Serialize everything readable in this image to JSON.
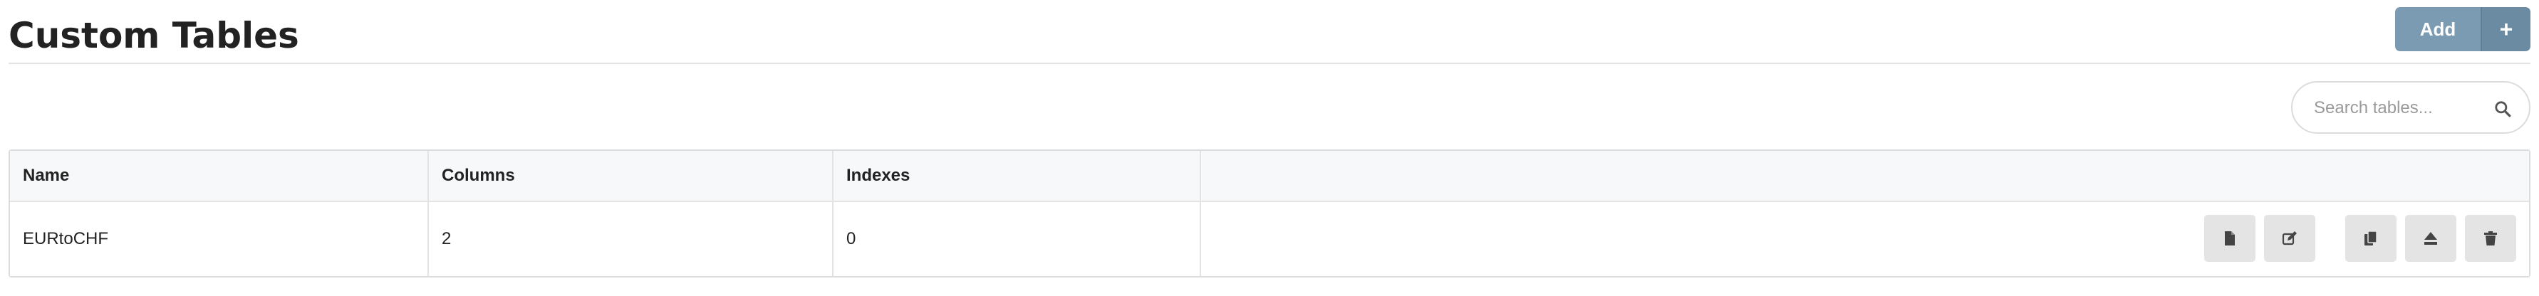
{
  "header": {
    "title": "Custom Tables",
    "add_label": "Add",
    "add_plus": "+"
  },
  "search": {
    "placeholder": "Search tables..."
  },
  "table": {
    "columns": [
      "Name",
      "Columns",
      "Indexes",
      ""
    ],
    "rows": [
      {
        "name": "EURtoCHF",
        "columns": "2",
        "indexes": "0"
      }
    ]
  },
  "row_actions": [
    "document-icon",
    "edit-icon",
    "copy-icon",
    "eject-icon",
    "trash-icon"
  ],
  "colors": {
    "add_button": "#7b9bb3",
    "action_button": "#e4e4e4",
    "header_row": "#f7f8f9"
  }
}
